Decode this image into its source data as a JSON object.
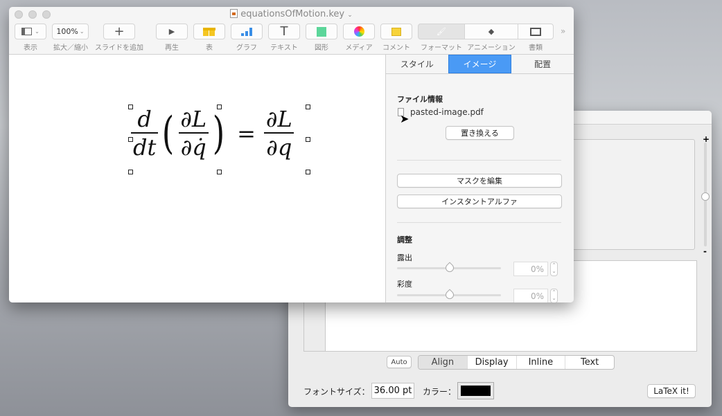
{
  "latexit": {
    "modes": [
      "Align",
      "Display",
      "Inline",
      "Text"
    ],
    "selected_mode": "Align",
    "auto_label": "Auto",
    "font_size_label": "フォントサイズ：",
    "font_size_value": "36.00 pt",
    "color_label": "カラー：",
    "color_value": "#000000",
    "latex_it_label": "LaTeX it!",
    "zoom_plus": "+",
    "zoom_minus": "-"
  },
  "keynote": {
    "title": "equationsOfMotion.key",
    "toolbar": [
      {
        "label": "表示",
        "icon": "sidebar-view-icon"
      },
      {
        "label": "拡大／縮小",
        "value": "100%"
      },
      {
        "label": "スライドを追加",
        "icon": "plus-icon"
      },
      {
        "label": "再生",
        "icon": "play-icon"
      },
      {
        "label": "表",
        "icon": "table-icon"
      },
      {
        "label": "グラフ",
        "icon": "chart-icon"
      },
      {
        "label": "テキスト",
        "icon": "text-icon"
      },
      {
        "label": "図形",
        "icon": "shape-icon"
      },
      {
        "label": "メディア",
        "icon": "media-icon"
      },
      {
        "label": "コメント",
        "icon": "comment-icon"
      },
      {
        "label": "フォーマット",
        "icon": "format-brush-icon"
      },
      {
        "label": "アニメーション",
        "icon": "animation-icon"
      },
      {
        "label": "書類",
        "icon": "document-icon"
      }
    ],
    "equation": {
      "d": "d",
      "dt": "dt",
      "dL": "∂L",
      "dqdot": "∂q̇",
      "equals": "=",
      "dq": "∂q",
      "lparen": "(",
      "rparen": ")"
    },
    "inspector": {
      "tabs": [
        "スタイル",
        "イメージ",
        "配置"
      ],
      "active_tab": "イメージ",
      "file_info_heading": "ファイル情報",
      "file_name": "pasted-image.pdf",
      "replace_button": "置き換える",
      "edit_mask_button": "マスクを編集",
      "instant_alpha_button": "インスタントアルファ",
      "adjust_heading": "調整",
      "exposure_label": "露出",
      "exposure_value": "0%",
      "saturation_label": "彩度",
      "saturation_value": "0%"
    }
  }
}
